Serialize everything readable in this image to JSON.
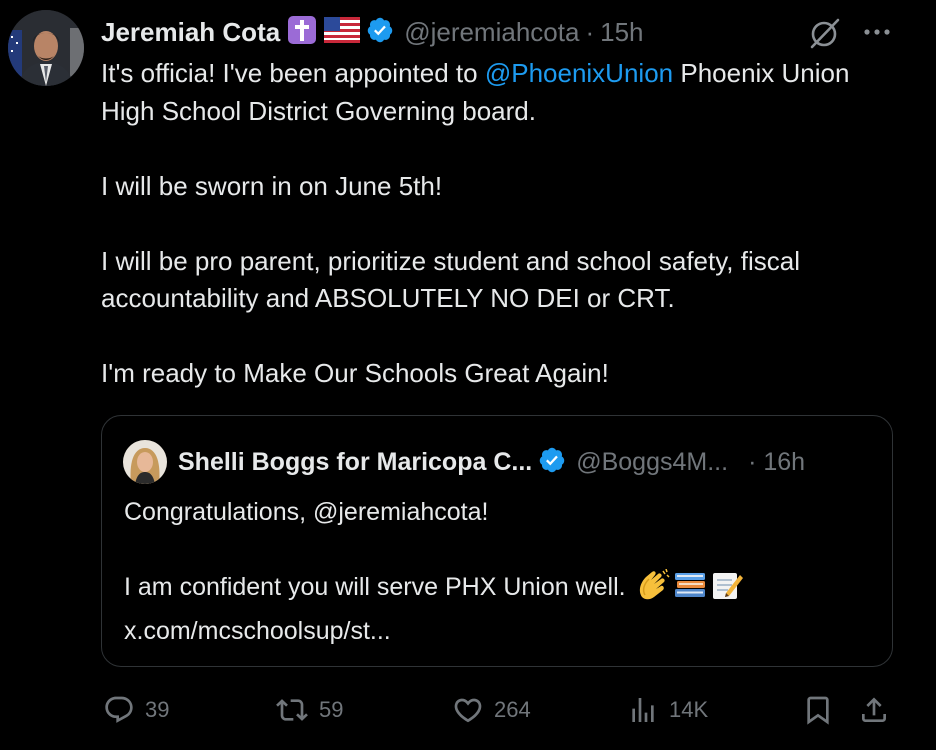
{
  "author": {
    "name": "Jeremiah Cota",
    "handle": "@jeremiahcota",
    "separator": "·",
    "time": "15h",
    "badges": [
      "cross-emoji",
      "us-flag-emoji",
      "verified-badge"
    ]
  },
  "tweet": {
    "line1_pre": "It's officia!  I've been appointed to ",
    "line1_mention": "@PhoenixUnion",
    "line1_post": " Phoenix Union High School District Governing board.",
    "para2": "I will be sworn in on June 5th!",
    "para3": "I will be pro parent, prioritize student and school safety, fiscal accountability and  ABSOLUTELY NO DEI or CRT.",
    "para4": "I'm ready to Make Our Schools Great Again!"
  },
  "quote": {
    "name": "Shelli Boggs for Maricopa C...",
    "handle": "@Boggs4M...",
    "time": "· 16h",
    "line1": "Congratulations, @jeremiahcota!",
    "line2": "I am confident you will serve PHX Union well.",
    "emojis": [
      "clapping-hands-emoji",
      "books-emoji",
      "memo-emoji"
    ],
    "link": "x.com/mcschoolsup/st..."
  },
  "actions": {
    "replies": "39",
    "reposts": "59",
    "likes": "264",
    "views": "14K"
  },
  "colors": {
    "background": "#000000",
    "text": "#e7e9ea",
    "muted": "#71767b",
    "accent": "#1d9bf0",
    "border": "#2f3336"
  }
}
